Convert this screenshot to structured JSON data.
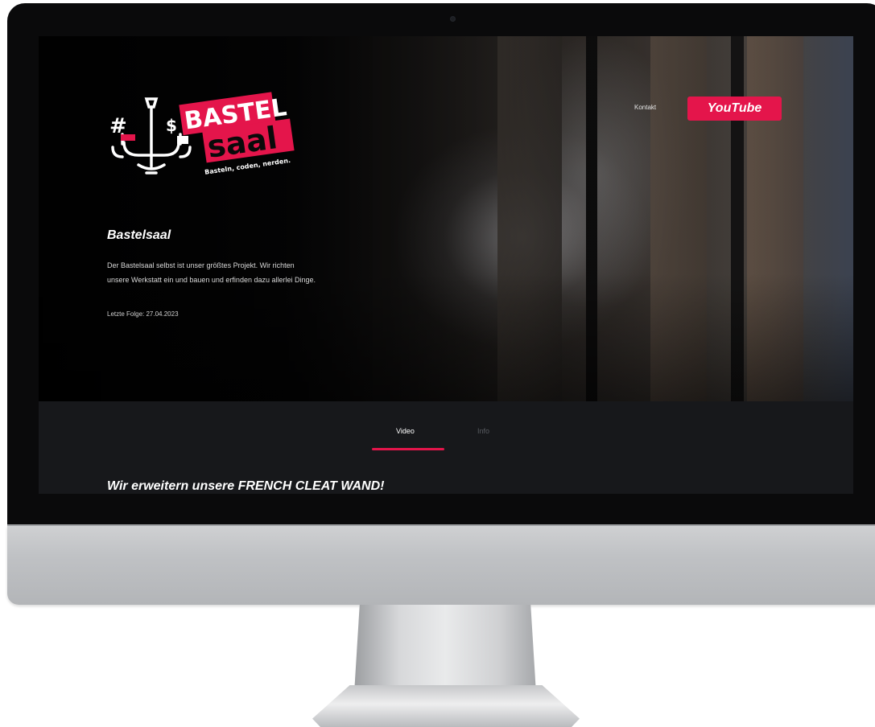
{
  "logo": {
    "word_top": "BASTEL",
    "word_bottom": "saal",
    "tagline": "Basteln, coden, nerden.",
    "colors": {
      "red": "#e4154b",
      "white": "#ffffff"
    }
  },
  "nav": {
    "contact_label": "Kontakt",
    "youtube_label": "YouTube"
  },
  "hero": {
    "title": "Bastelsaal",
    "description": "Der Bastelsaal selbst ist unser größtes Projekt. Wir richten\nunsere Werkstatt ein und bauen und erfinden dazu allerlei Dinge.",
    "last_episode": "Letzte Folge: 27.04.2023"
  },
  "tabs": [
    {
      "label": "Video",
      "active": true
    },
    {
      "label": "Info",
      "active": false
    }
  ],
  "episode": {
    "title": "Wir erweitern unsere FRENCH CLEAT WAND!"
  },
  "theme": {
    "accent": "#e4154b",
    "background": "#17181b"
  }
}
